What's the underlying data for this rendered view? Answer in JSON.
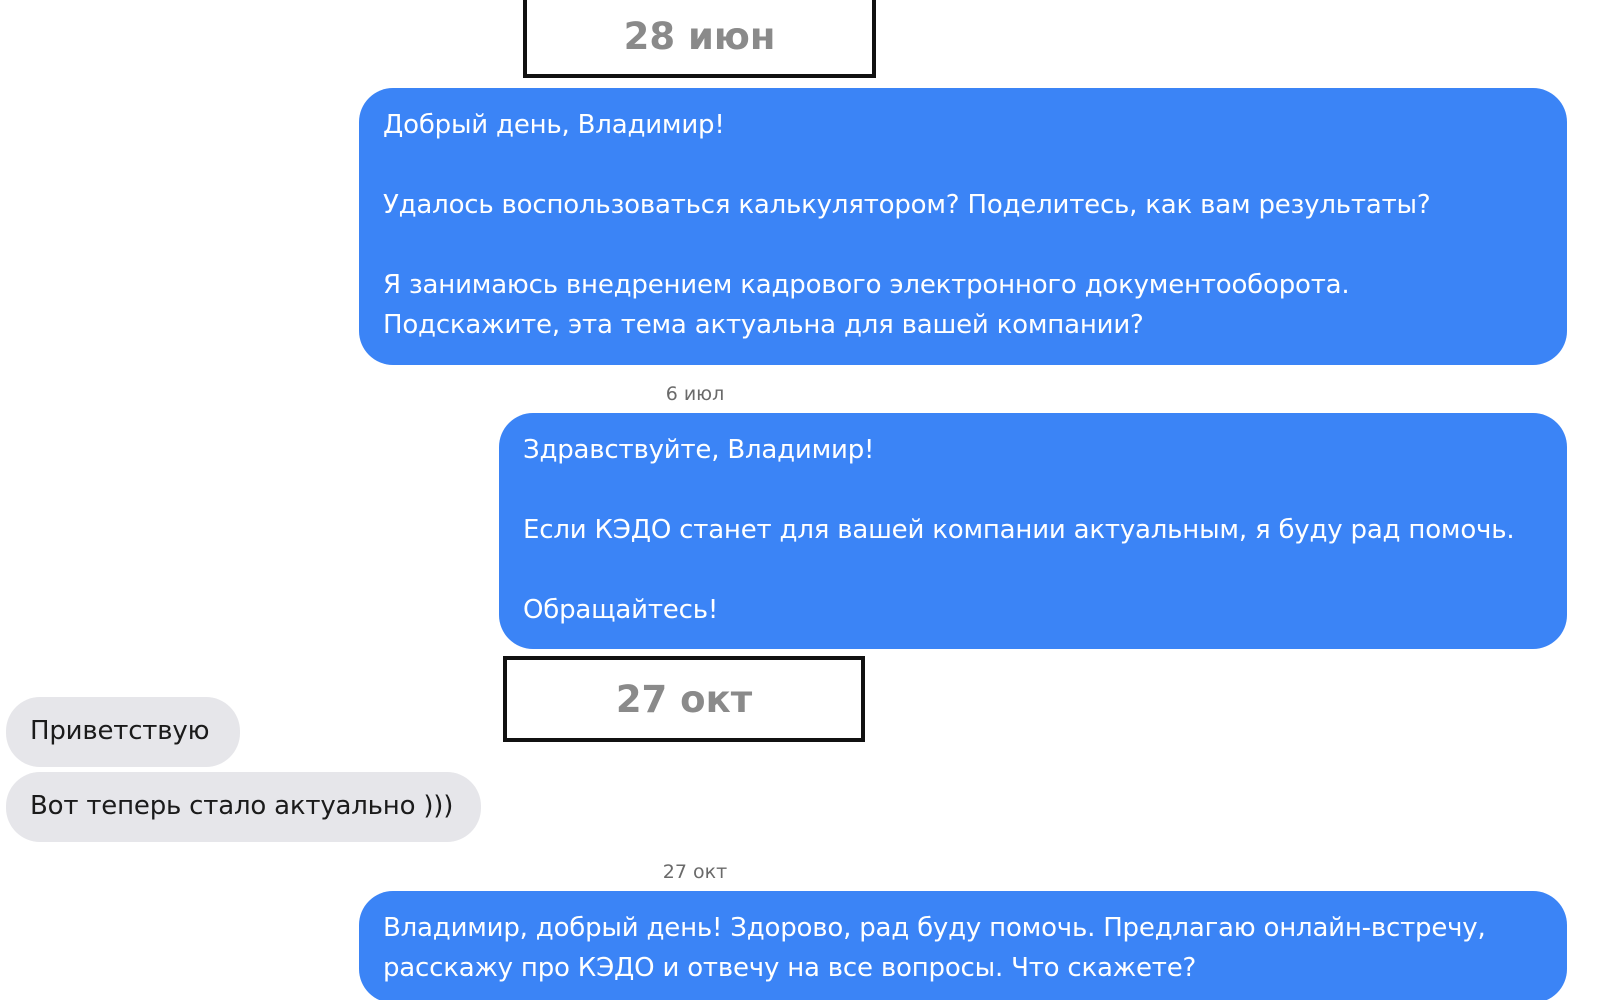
{
  "colors": {
    "outgoing_bubble": "#3b84f6",
    "incoming_bubble": "#e6e6ea",
    "date_text": "#8a8a8a"
  },
  "date_highlights": [
    "28 июн",
    "27 окт"
  ],
  "messages": [
    {
      "direction": "outgoing",
      "text": "Добрый день, Владимир!\n\nУдалось воспользоваться калькулятором? Поделитесь, как вам результаты?\n\nЯ занимаюсь внедрением кадрового электронного документооборота.\nПодскажите, эта тема актуальна для вашей компании?"
    },
    {
      "direction": "outgoing",
      "date_label": "6 июл",
      "text": "Здравствуйте, Владимир!\n\nЕсли КЭДО станет для вашей компании актуальным, я буду рад помочь.\n\nОбращайтесь!"
    },
    {
      "direction": "incoming",
      "text": "Приветствую"
    },
    {
      "direction": "incoming",
      "text": "Вот теперь стало актуально )))"
    },
    {
      "direction": "outgoing",
      "date_label": "27 окт",
      "text": "Владимир, добрый день! Здорово, рад буду помочь. Предлагаю онлайн-встречу,\nрасскажу про КЭДО и отвечу на все вопросы. Что скажете?"
    }
  ]
}
